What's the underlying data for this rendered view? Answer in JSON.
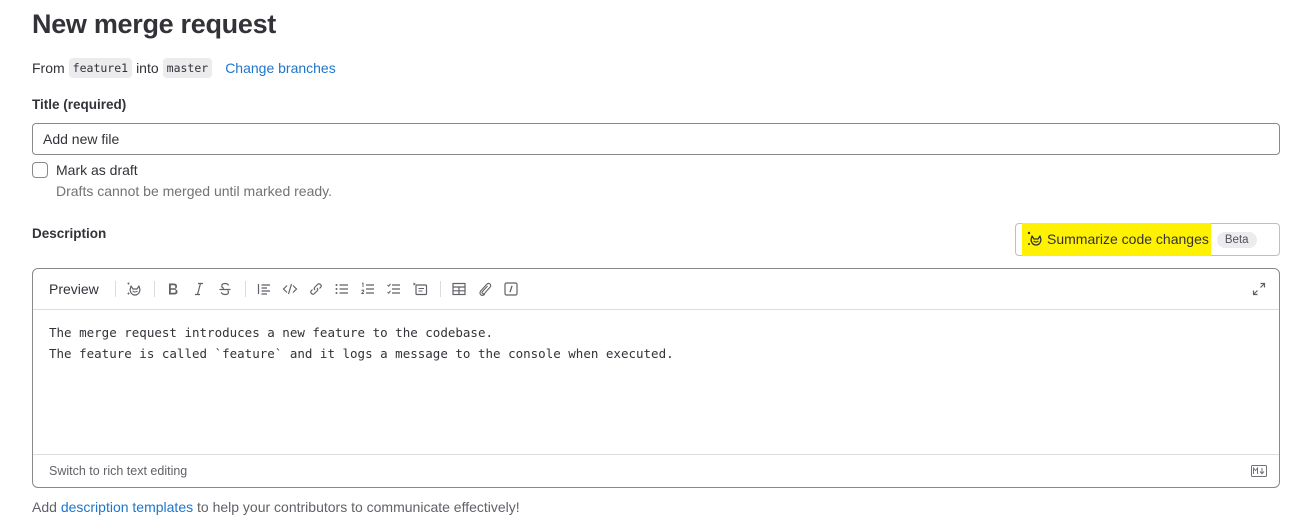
{
  "page": {
    "title": "New merge request"
  },
  "branches": {
    "from_label": "From",
    "source": "feature1",
    "into_label": "into",
    "target": "master",
    "change_link": "Change branches"
  },
  "title_field": {
    "label": "Title (required)",
    "value": "Add new file"
  },
  "draft": {
    "label": "Mark as draft",
    "checked": false,
    "help": "Drafts cannot be merged until marked ready."
  },
  "description": {
    "label": "Description",
    "summarize_button": "Summarize code changes",
    "summarize_badge": "Beta",
    "highlight_color": "#fff200",
    "toolbar": {
      "preview_label": "Preview",
      "buttons": [
        {
          "name": "gitlab-duo",
          "icon": "tanuki-ai-icon"
        },
        {
          "name": "bold",
          "icon": "bold-icon"
        },
        {
          "name": "italic",
          "icon": "italic-icon"
        },
        {
          "name": "strikethrough",
          "icon": "strikethrough-icon"
        },
        {
          "name": "quote",
          "icon": "quote-icon"
        },
        {
          "name": "code",
          "icon": "code-icon"
        },
        {
          "name": "link",
          "icon": "link-icon"
        },
        {
          "name": "bullet-list",
          "icon": "list-bulleted-icon"
        },
        {
          "name": "numbered-list",
          "icon": "list-numbered-icon"
        },
        {
          "name": "task-list",
          "icon": "list-task-icon"
        },
        {
          "name": "collapsible-section",
          "icon": "details-block-icon"
        },
        {
          "name": "table",
          "icon": "table-icon"
        },
        {
          "name": "attach-file",
          "icon": "paperclip-icon"
        },
        {
          "name": "quick-actions",
          "icon": "slash-command-icon"
        }
      ],
      "fullscreen_icon": "maximize-icon"
    },
    "content_lines": [
      "The merge request introduces a new feature to the codebase.",
      "The feature is called `feature` and it logs a message to the console when executed."
    ],
    "switch_label": "Switch to rich text editing",
    "markdown_icon": "markdown-icon"
  },
  "footer": {
    "prefix": "Add",
    "link": "description templates",
    "suffix": "to help your contributors to communicate effectively!"
  },
  "colors": {
    "link": "#1f75cb",
    "text": "#333238",
    "muted": "#737278"
  }
}
